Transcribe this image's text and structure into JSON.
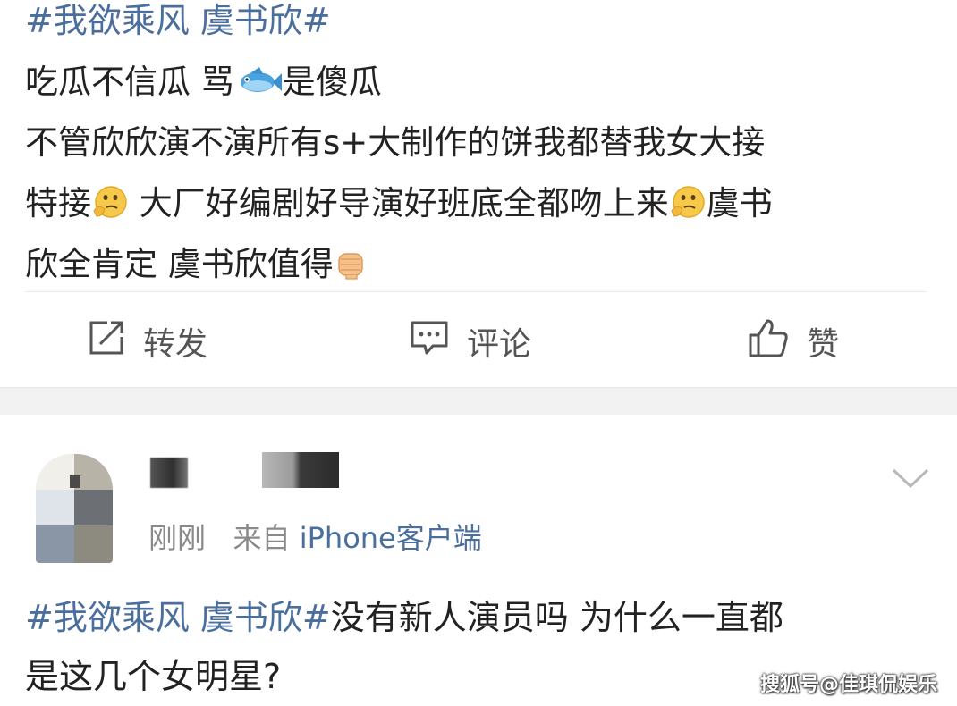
{
  "post": {
    "hashtag": "#我欲乘风 虞书欣#",
    "line1_a": "吃瓜不信瓜 骂",
    "line1_b": "是傻瓜",
    "line2": "不管欣欣演不演所有s+大制作的饼我都替我女大接",
    "line3_a": "特接",
    "line3_b": " 大厂好编剧好导演好班底全都吻上来",
    "line3_c": "虞书",
    "line4": "欣全肯定 虞书欣值得",
    "emoji_icons": [
      "fish-icon",
      "thinking-face-icon",
      "fist-icon"
    ]
  },
  "actions": {
    "repost": "转发",
    "comment": "评论",
    "like": "赞"
  },
  "comment_card": {
    "time": "刚刚",
    "from_prefix": "来自 ",
    "source": "iPhone客户端",
    "hashtag": "#我欲乘风 虞书欣#",
    "text_a": "没有新人演员吗 为什么一直都",
    "text_b": "是这几个女明星?"
  },
  "watermark": "搜狐号@佳琪侃娱乐",
  "colors": {
    "link": "#4a6f9e",
    "text": "#222222",
    "meta": "#8a8a8a",
    "band": "#f2f2f2"
  }
}
